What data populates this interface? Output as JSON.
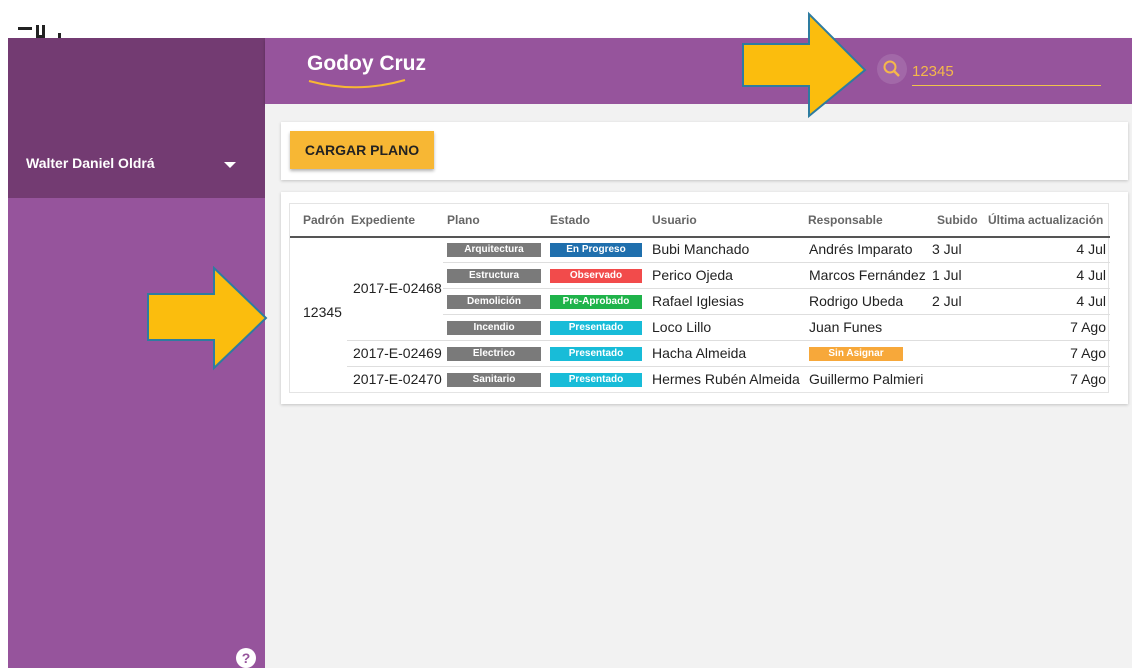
{
  "colors": {
    "sidebar": "#96549c",
    "sidebar_dark": "#733b72",
    "header": "#96549c",
    "accent_button": "#f7b734",
    "search_text": "#f5b84a",
    "arrow_fill": "#fbbd0d",
    "arrow_stroke": "#2e7ca0"
  },
  "sidebar": {
    "user_name": "Walter Daniel Oldrá",
    "user_menu_icon": "caret-down-icon",
    "help_icon": "help-icon",
    "help_glyph": "?"
  },
  "header": {
    "logo_text": "Godoy Cruz",
    "search_icon": "search-icon",
    "search_value": "12345"
  },
  "toolbar": {
    "upload_label": "CARGAR PLANO"
  },
  "table": {
    "columns": [
      "Padrón",
      "Expediente",
      "Plano",
      "Estado",
      "Usuario",
      "Responsable",
      "Subido",
      "Última actualización"
    ],
    "padron": "12345",
    "expedientes": [
      "2017-E-02468",
      "2017-E-02469",
      "2017-E-02470"
    ],
    "rows": [
      {
        "plano": "Arquitectura",
        "estado": "En Progreso",
        "estado_color": "#1f6fad",
        "usuario": "Bubi Manchado",
        "responsable": "Andrés Imparato",
        "subido": "3 Jul",
        "actualizacion": "4 Jul"
      },
      {
        "plano": "Estructura",
        "estado": "Observado",
        "estado_color": "#f24b4b",
        "usuario": "Perico Ojeda",
        "responsable": "Marcos Fernández",
        "subido": "1 Jul",
        "actualizacion": "4 Jul"
      },
      {
        "plano": "Demolición",
        "estado": "Pre-Aprobado",
        "estado_color": "#1fb34a",
        "usuario": "Rafael Iglesias",
        "responsable": "Rodrigo Ubeda",
        "subido": "2 Jul",
        "actualizacion": "4 Jul"
      },
      {
        "plano": "Incendio",
        "estado": "Presentado",
        "estado_color": "#18bcd8",
        "usuario": "Loco Lillo",
        "responsable": "Juan Funes",
        "subido": "",
        "actualizacion": "7 Ago"
      },
      {
        "plano": "Electrico",
        "estado": "Presentado",
        "estado_color": "#18bcd8",
        "usuario": "Hacha Almeida",
        "responsable": "Sin Asignar",
        "responsable_badge": true,
        "subido": "",
        "actualizacion": "7 Ago"
      },
      {
        "plano": "Sanitario",
        "estado": "Presentado",
        "estado_color": "#18bcd8",
        "usuario": "Hermes Rubén Almeida",
        "responsable": "Guillermo Palmieri",
        "subido": "",
        "actualizacion": "7 Ago"
      }
    ],
    "plano_badge_color": "#7a7a7a",
    "unassigned_badge_color": "#f7a83a"
  },
  "annotations": {
    "arrow_icon": "arrow-icon"
  }
}
